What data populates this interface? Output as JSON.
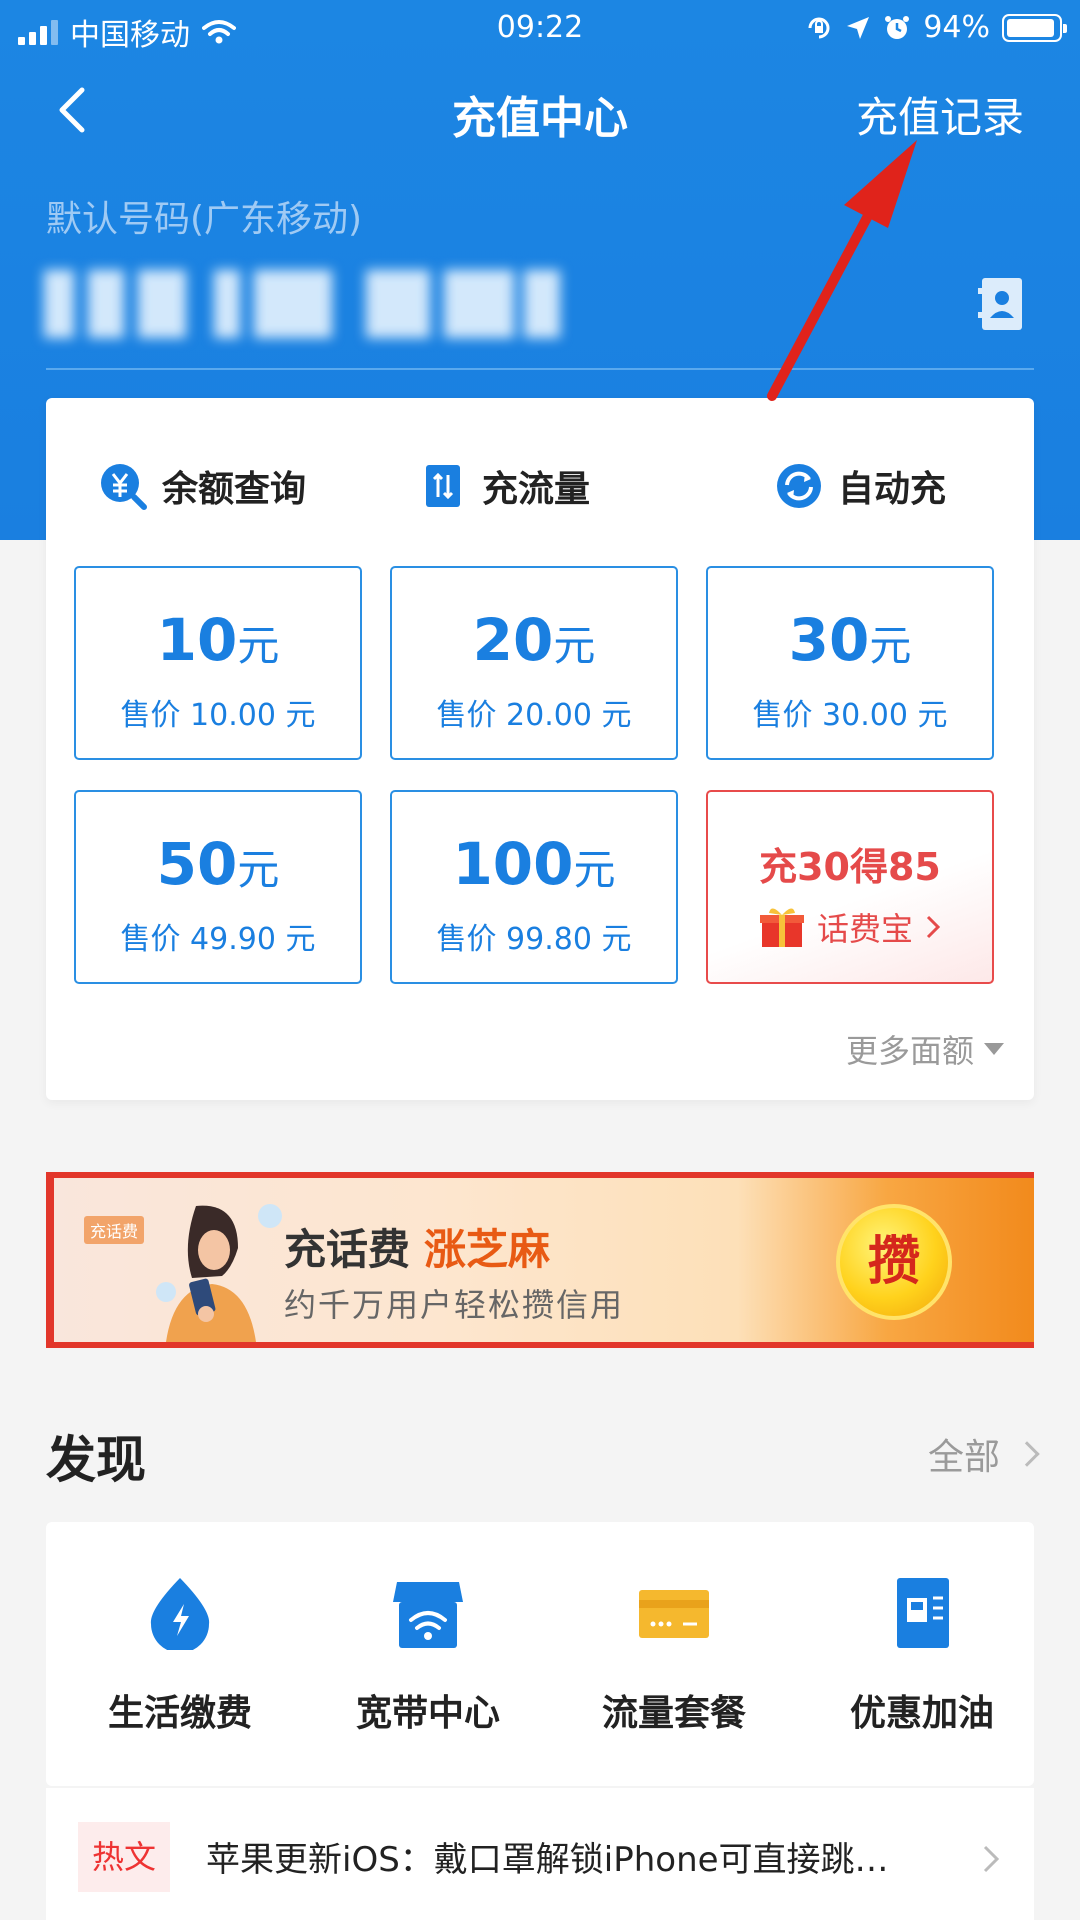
{
  "status_bar": {
    "carrier": "中国移动",
    "time": "09:22",
    "battery": "94%",
    "battery_level": 0.94
  },
  "nav": {
    "title": "充值中心",
    "record": "充值记录"
  },
  "phone": {
    "label": "默认号码(广东移动)"
  },
  "quick_actions": [
    {
      "label": "余额查询",
      "icon": "yuan-search-icon"
    },
    {
      "label": "充流量",
      "icon": "data-transfer-icon"
    },
    {
      "label": "自动充",
      "icon": "auto-refresh-icon"
    }
  ],
  "amounts": [
    {
      "value": "10",
      "unit": "元",
      "price": "售价 10.00 元"
    },
    {
      "value": "20",
      "unit": "元",
      "price": "售价 20.00 元"
    },
    {
      "value": "30",
      "unit": "元",
      "price": "售价 30.00 元"
    },
    {
      "value": "50",
      "unit": "元",
      "price": "售价 49.90 元"
    },
    {
      "value": "100",
      "unit": "元",
      "price": "售价 99.80 元"
    }
  ],
  "promo": {
    "title": "充30得85",
    "link": "话费宝"
  },
  "more_amounts": "更多面额",
  "banner": {
    "tag": "充话费",
    "title": "充话费",
    "highlight": "涨芝麻",
    "subtitle": "约千万用户轻松攒信用",
    "coin": "攒"
  },
  "discover": {
    "title": "发现",
    "all": "全部",
    "services": [
      {
        "label": "生活缴费",
        "icon": "water-drop-icon"
      },
      {
        "label": "宽带中心",
        "icon": "wifi-store-icon"
      },
      {
        "label": "流量套餐",
        "icon": "card-icon"
      },
      {
        "label": "优惠加油",
        "icon": "fuel-icon"
      }
    ],
    "news": {
      "tag": "热文",
      "text": "苹果更新iOS：戴口罩解锁iPhone可直接跳…"
    }
  },
  "colors": {
    "primary": "#1a7fe0",
    "promo": "#e54a4a",
    "arrow": "#e0231b"
  }
}
